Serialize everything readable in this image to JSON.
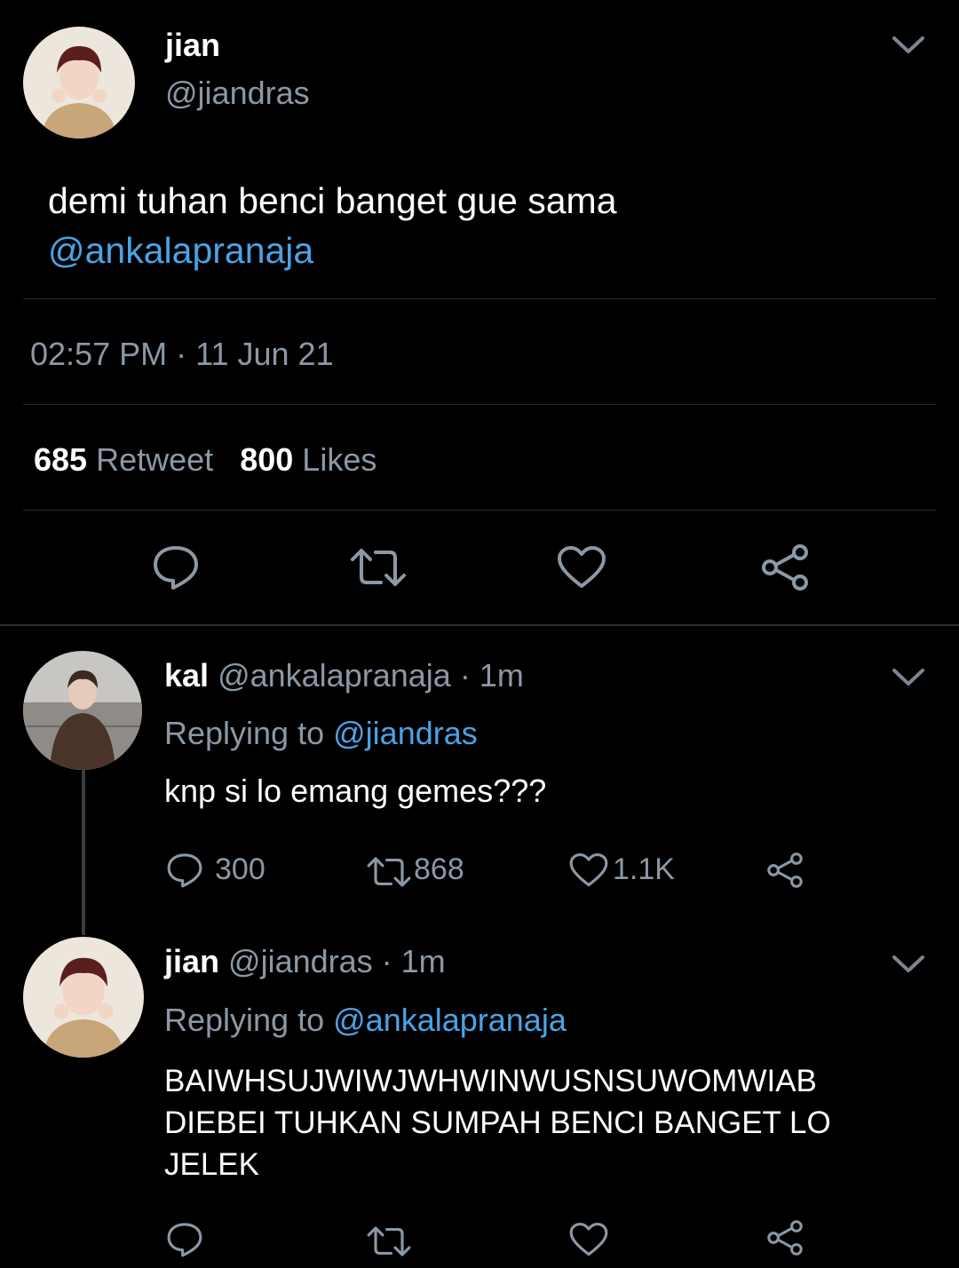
{
  "main_tweet": {
    "display_name": "jian",
    "handle": "@jiandras",
    "text_line1": "demi tuhan benci banget gue sama",
    "mention": "@ankalapranaja",
    "time": "02:57 PM",
    "separator": "·",
    "date": "11 Jun 21",
    "retweet_count": "685",
    "retweet_label": "Retweet",
    "like_count": "800",
    "like_label": "Likes"
  },
  "replies": [
    {
      "display_name": "kal",
      "handle": "@ankalapranaja",
      "age": "· 1m",
      "replying_label": "Replying to",
      "replying_to": "@jiandras",
      "text": "knp si lo emang gemes???",
      "reply_count": "300",
      "retweet_count": "868",
      "like_count": "1.1K"
    },
    {
      "display_name": "jian",
      "handle": "@jiandras",
      "age": "· 1m",
      "replying_label": "Replying to",
      "replying_to": "@ankalapranaja",
      "text_lines": [
        "BAIWHSUJWIWJWHWINWUSNSUWOMWIAB",
        "DIEBEI TUHKAN SUMPAH BENCI BANGET LO",
        "JELEK"
      ]
    }
  ],
  "icons": {
    "reply": "speech-bubble-icon",
    "retweet": "retweet-icon",
    "like": "heart-icon",
    "share": "share-icon",
    "more": "chevron-down-icon"
  },
  "colors": {
    "background": "#000000",
    "link": "#4aa3e6",
    "muted": "#8b98a5",
    "divider": "#2a2d30"
  }
}
